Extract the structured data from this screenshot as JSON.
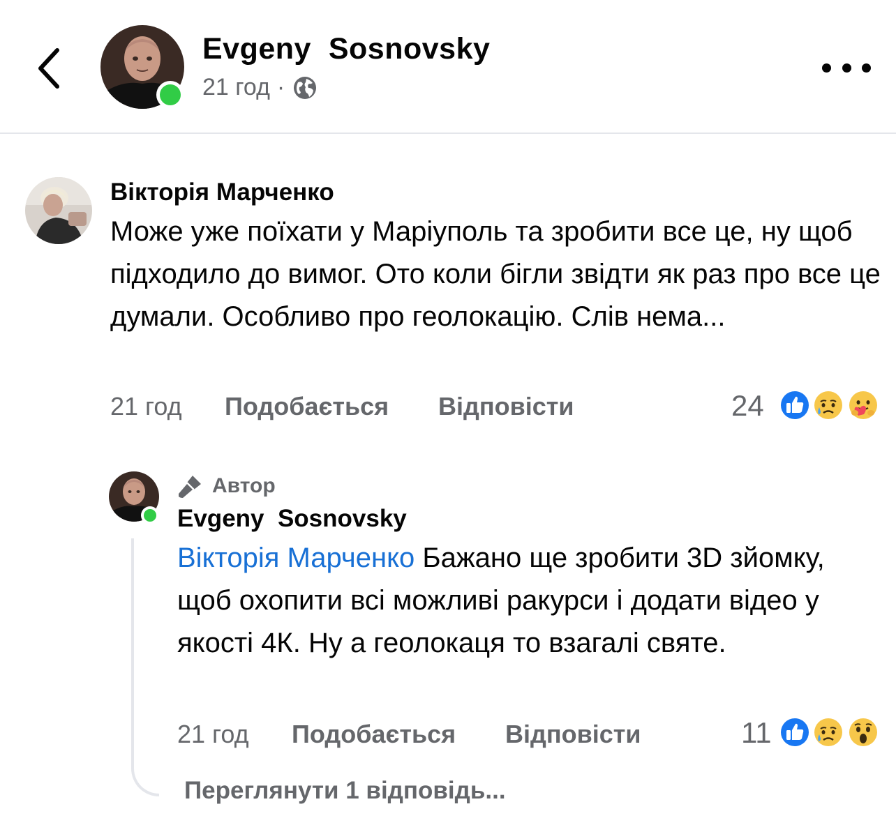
{
  "header": {
    "author_name": "Evgeny  Sosnovsky",
    "time": "21 год",
    "separator": "·",
    "icons": {
      "back": "chevron-left-icon",
      "visibility": "globe-icon",
      "menu": "more-dots-icon"
    }
  },
  "comment": {
    "author": "Вікторія Марченко",
    "text": "Може уже поїхати у Маріуполь  та зробити все це, ну щоб підходило до вимог. Ото коли бігли звідти як раз про все це думали. Особливо про геолокацію. Слів нема...",
    "time": "21 год",
    "like_label": "Подобається",
    "reply_label": "Відповісти",
    "reaction_count": "24",
    "reactions": [
      "like",
      "sad",
      "care"
    ]
  },
  "reply": {
    "badge": "Автор",
    "author": "Evgeny  Sosnovsky",
    "mention": "Вікторія Марченко",
    "text": " Бажано ще зробити 3D зйомку, щоб охопити всі можливі ракурси і додати відео у якості 4К. Ну а геолокаця то взагалі святе.",
    "time": "21 год",
    "like_label": "Подобається",
    "reply_label": "Відповісти",
    "reaction_count": "11",
    "reactions": [
      "like",
      "sad",
      "wow"
    ]
  },
  "view_replies_label": "Переглянути 1 відповідь...",
  "colors": {
    "accent_blue": "#1870d5",
    "muted_text": "#65676b",
    "online_green": "#31cc46",
    "divider": "#e4e6eb"
  }
}
